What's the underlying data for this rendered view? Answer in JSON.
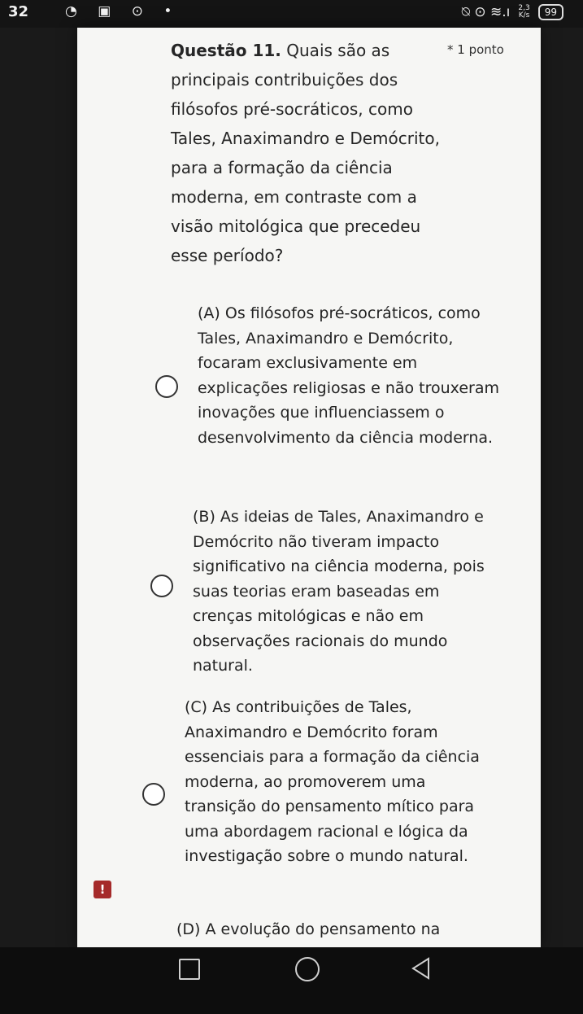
{
  "status_bar": {
    "time": "32",
    "left_icons": "◔ ▣ ⊙ •",
    "right_icons": "⍉ ⊙ ≋.ı",
    "speed_value": "2,3",
    "speed_unit": "K/s",
    "battery": "99"
  },
  "question": {
    "prefix": "Questão 11.",
    "text": "Quais são as principais contribuições dos filósofos pré-socráticos, como Tales, Anaximandro e Demócrito, para a formação da ciência moderna, em contraste com a visão mitológica que precedeu esse período?",
    "points": "* 1 ponto"
  },
  "options": [
    {
      "label": "(A) Os filósofos pré-socráticos, como Tales, Anaximandro e Demócrito, focaram exclusivamente em explicações religiosas e não trouxeram inovações que influenciassem o desenvolvimento da ciência moderna."
    },
    {
      "label": "(B) As ideias de Tales, Anaximandro e Demócrito não tiveram impacto significativo na ciência moderna, pois suas teorias eram baseadas em crenças mitológicas e não em observações racionais do mundo natural."
    },
    {
      "label": "(C) As contribuições de Tales, Anaximandro e Demócrito foram essenciais para a formação da ciência moderna, ao promoverem uma transição do pensamento mítico para uma abordagem racional e lógica da investigação sobre o mundo natural."
    },
    {
      "label": "(D) A evolução do pensamento na"
    }
  ],
  "warning_badge": "!"
}
